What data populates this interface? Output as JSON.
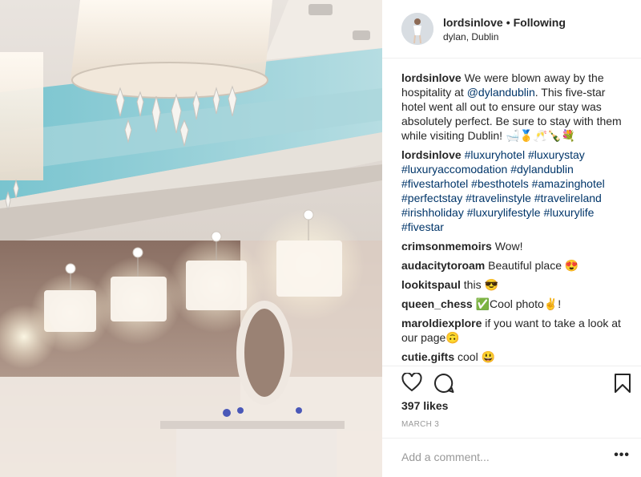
{
  "post": {
    "username": "lordsinlove",
    "follow_separator": "•",
    "follow_status": "Following",
    "location": "dylan, Dublin"
  },
  "caption": {
    "username": "lordsinlove",
    "text_before": "We were blown away by the hospitality at",
    "mention": "@dylandublin",
    "text_after": ". This five-star hotel went all out to ensure our stay was absolutely perfect. Be sure to stay with them while visiting Dublin! 🛁🥇🥂🍾💐"
  },
  "hashtag_comment": {
    "username": "lordsinlove",
    "tags": [
      "#luxuryhotel",
      "#luxurystay",
      "#luxuryaccomodation",
      "#dylandublin",
      "#fivestarhotel",
      "#besthotels",
      "#amazinghotel",
      "#perfectstay",
      "#travelinstyle",
      "#travelireland",
      "#irishholiday",
      "#luxurylifestyle",
      "#luxurylife",
      "#fivestar"
    ]
  },
  "comments": [
    {
      "username": "crimsonmemoirs",
      "text": "Wow!"
    },
    {
      "username": "audacitytoroam",
      "text": "Beautiful place 😍"
    },
    {
      "username": "lookitspaul",
      "text": "this 😎"
    },
    {
      "username": "queen_chess",
      "text": "✅Cool photo✌️!"
    },
    {
      "username": "maroldiexplore",
      "text": "if you want to take a look at our page🙃"
    },
    {
      "username": "cutie.gifts",
      "text": "cool 😃"
    }
  ],
  "icons": {
    "like": "heart-icon",
    "comment": "comment-bubble-icon",
    "save": "bookmark-icon",
    "more": "more-options-icon"
  },
  "likes_text": "397 likes",
  "date_text": "MARCH 3",
  "add_comment_placeholder": "Add a comment...",
  "more_label": "•••"
}
